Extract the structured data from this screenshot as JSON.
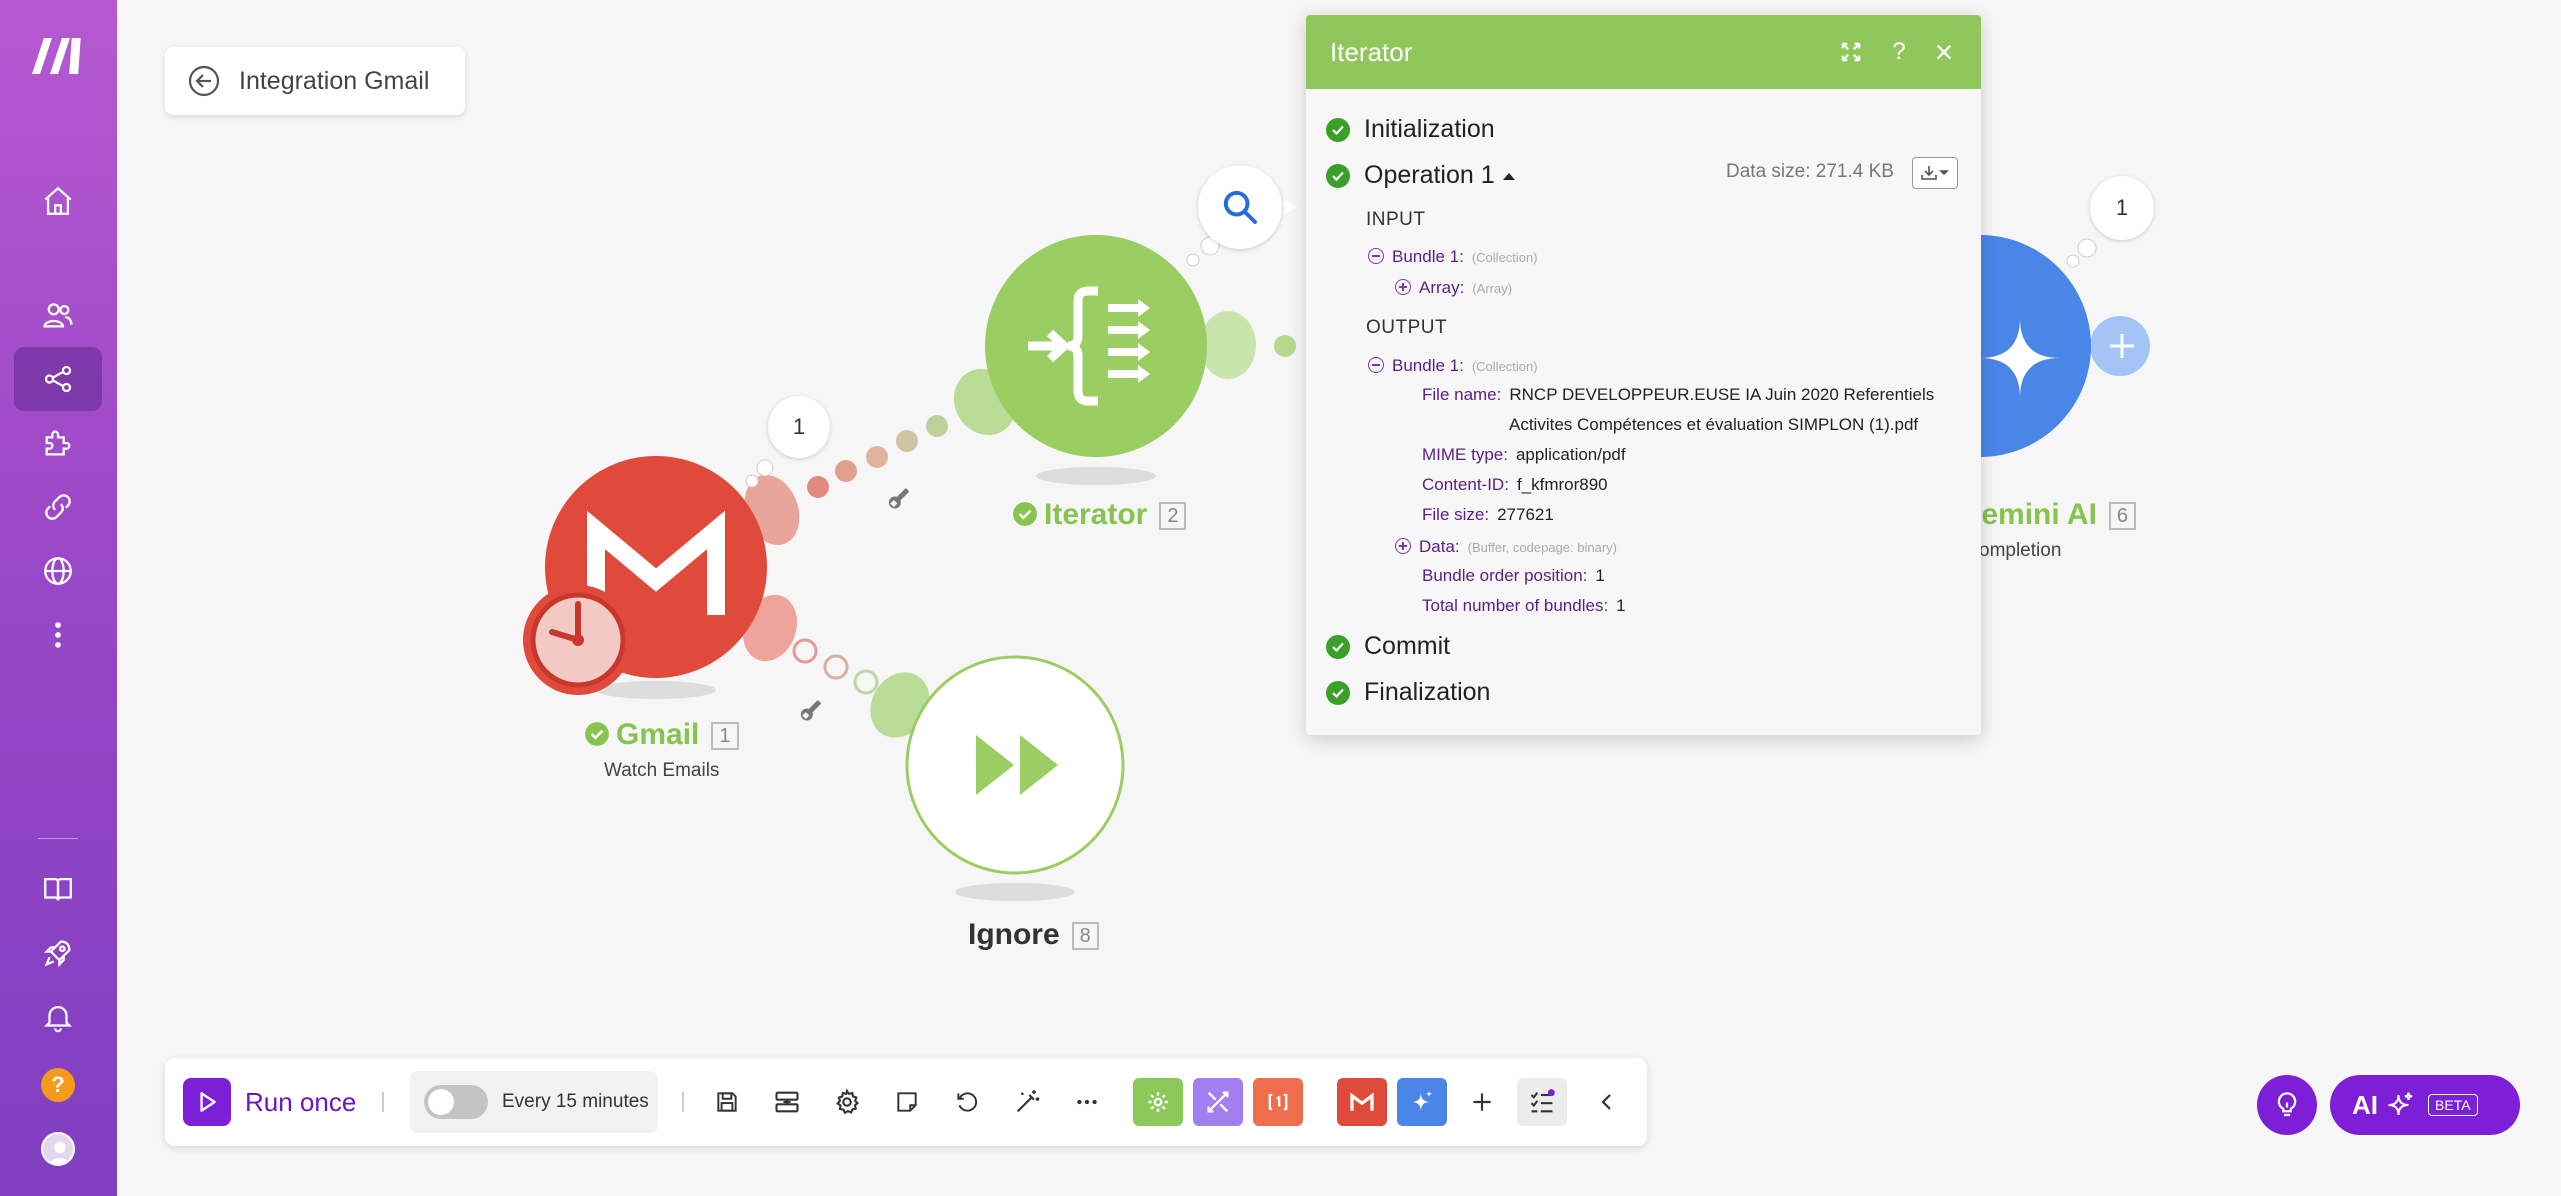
{
  "window": {
    "title": "Integration Gmail"
  },
  "sidebar": {
    "items": [
      {
        "icon": "home-icon"
      },
      {
        "icon": "users-icon"
      },
      {
        "icon": "share-icon",
        "active": true
      },
      {
        "icon": "puzzle-icon"
      },
      {
        "icon": "link-icon"
      },
      {
        "icon": "globe-icon"
      },
      {
        "icon": "more-icon"
      }
    ],
    "bottom_items": [
      {
        "icon": "book-icon"
      },
      {
        "icon": "rocket-icon"
      },
      {
        "icon": "bell-icon"
      },
      {
        "icon": "help-icon",
        "label": "?"
      },
      {
        "icon": "avatar-icon"
      }
    ]
  },
  "modules": {
    "gmail": {
      "name": "Gmail",
      "number": "1",
      "subtitle": "Watch Emails",
      "bubble": "1"
    },
    "iterator": {
      "name": "Iterator",
      "number": "2"
    },
    "ignore": {
      "name": "Ignore",
      "number": "8"
    },
    "gemini": {
      "name": "Gemini AI",
      "number": "6",
      "subtitle": "ompletion",
      "bubble": "1"
    }
  },
  "panel": {
    "title": "Iterator",
    "controls": {
      "help": "?",
      "close": "×"
    },
    "phases": {
      "initialization": "Initialization",
      "operation": "Operation 1",
      "commit": "Commit",
      "finalization": "Finalization"
    },
    "data_size": "Data size: 271.4 KB",
    "input": {
      "header": "INPUT",
      "bundle_label": "Bundle 1:",
      "bundle_type": "(Collection)",
      "array_label": "Array:",
      "array_type": "(Array)"
    },
    "output": {
      "header": "OUTPUT",
      "bundle_label": "Bundle 1:",
      "bundle_type": "(Collection)",
      "fields": {
        "file_name_label": "File name:",
        "file_name_line1": "RNCP DEVELOPPEUR.EUSE  IA Juin 2020 Referentiels",
        "file_name_line2": "Activites Compétences et évaluation SIMPLON  (1).pdf",
        "mime_label": "MIME type:",
        "mime_value": "application/pdf",
        "content_id_label": "Content-ID:",
        "content_id_value": "f_kfmror890",
        "file_size_label": "File size:",
        "file_size_value": "277621",
        "data_label": "Data:",
        "data_type": "(Buffer, codepage: binary)",
        "order_label": "Bundle order position:",
        "order_value": "1",
        "total_label": "Total number of bundles:",
        "total_value": "1"
      }
    }
  },
  "toolbar": {
    "run_label": "Run once",
    "schedule_label": "Every 15 minutes",
    "schedule_enabled": false
  },
  "ai_button": {
    "label": "AI",
    "badge": "BETA"
  },
  "colors": {
    "accent": "#7b1fd8",
    "sidebar_top": "#b659d0",
    "sidebar_bottom": "#7f3fc0",
    "gmail": "#e04a3a",
    "iterator": "#9bce62",
    "gemini": "#4a86e8",
    "panel_header": "#8fc75c"
  }
}
